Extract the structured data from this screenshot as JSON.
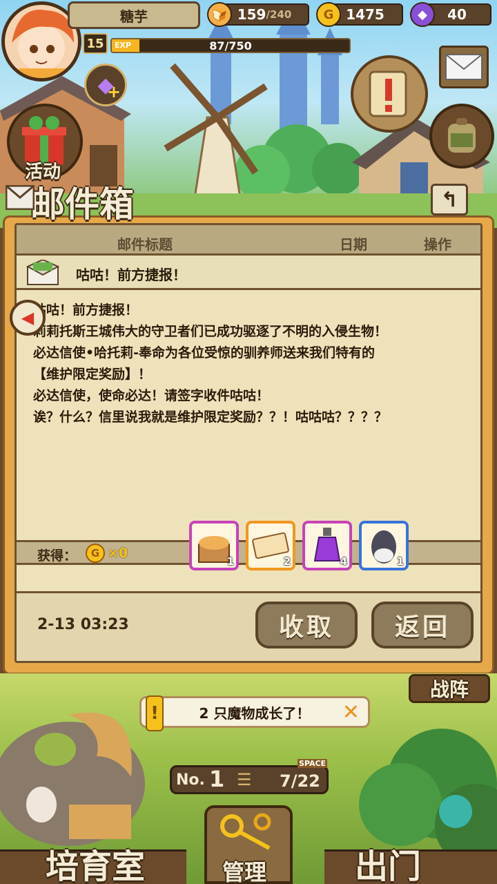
{
  "player": {
    "name": "糖芋",
    "level": "15",
    "exp_label": "EXP",
    "exp": "87/750",
    "exp_fraction": 0.116
  },
  "resources": {
    "stamina_value": "159",
    "stamina_max": "/240",
    "gold": "1475",
    "gems": "40"
  },
  "side": {
    "event_label": "活动"
  },
  "mailbox": {
    "title": "邮件箱",
    "col_subject": "邮件标题",
    "col_date": "日期",
    "col_action": "操作",
    "subject": "咕咕！前方捷报！",
    "body_lines": [
      "咕咕！前方捷报！",
      "莉莉托斯王城伟大的守卫者们已成功驱逐了不明的入侵生物！",
      "必达信使•哈托莉-奉命为各位受惊的驯养师送来我们特有的",
      "【维护限定奖励】！",
      "必达信使，使命必达！请签字收件咕咕！",
      "诶？什么？信里说我就是维护限定奖励？？！咕咕咕？？？？"
    ],
    "reward_label": "获得：",
    "reward_gold": "×0",
    "items": [
      {
        "name": "bread-basket",
        "qty": "1",
        "color": "#c742b8"
      },
      {
        "name": "ticket",
        "qty": "2",
        "color": "#f0971e"
      },
      {
        "name": "purple-potion",
        "qty": "4",
        "color": "#c742b8"
      },
      {
        "name": "egg",
        "qty": "1",
        "color": "#3a73d9"
      }
    ],
    "date": "2-13 03:23",
    "collect_label": "收取",
    "back_label": "返回"
  },
  "notification": {
    "text": "2 只魔物成长了！"
  },
  "bottom": {
    "formation_label": "战阵",
    "space_label": "SPACE",
    "no_prefix": "No.",
    "no_value": "1",
    "space_value": "7/22",
    "incubator_label": "培育室",
    "manage_label": "管理",
    "depart_label": "出门"
  }
}
